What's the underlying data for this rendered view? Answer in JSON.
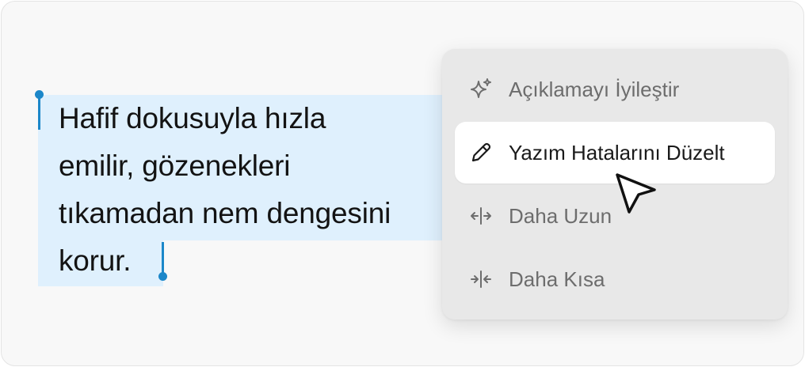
{
  "selection": {
    "lines": [
      "Hafif dokusuyla hızla",
      "emilir, gözenekleri",
      "tıkamadan nem dengesini",
      "korur."
    ]
  },
  "menu": {
    "items": [
      {
        "label": "Açıklamayı İyileştir",
        "icon": "sparkles-icon",
        "state": "default"
      },
      {
        "label": "Yazım Hatalarını Düzelt",
        "icon": "pencil-icon",
        "state": "hovered"
      },
      {
        "label": "Daha Uzun",
        "icon": "expand-horizontal-icon",
        "state": "default"
      },
      {
        "label": "Daha Kısa",
        "icon": "collapse-horizontal-icon",
        "state": "default"
      }
    ]
  },
  "colors": {
    "selection_highlight": "#dff0fd",
    "selection_handle": "#1c87c9",
    "menu_background": "#e8e8e8",
    "menu_item_active": "#ffffff",
    "menu_text": "#6d6d6d",
    "menu_text_active": "#1a1a1a"
  }
}
